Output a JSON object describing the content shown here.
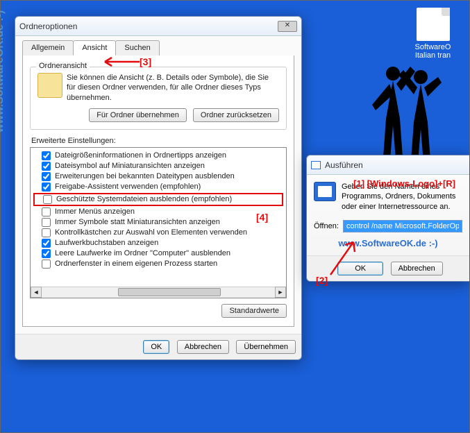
{
  "desktop": {
    "file_label": "SoftwareO\nItalian tran"
  },
  "watermark": "www.SoftwareOK.de :-)",
  "folder_options": {
    "title": "Ordneroptionen",
    "tabs": {
      "general": "Allgemein",
      "view": "Ansicht",
      "search": "Suchen"
    },
    "folderview": {
      "legend": "Ordneransicht",
      "desc": "Sie können die Ansicht (z. B. Details oder Symbole), die Sie für diesen Ordner verwenden, für alle Ordner dieses Typs übernehmen.",
      "apply_btn": "Für Ordner übernehmen",
      "reset_btn": "Ordner zurücksetzen"
    },
    "adv_label": "Erweiterte Einstellungen:",
    "items": [
      {
        "label": "Dateigrößeninformationen in Ordnertipps anzeigen",
        "checked": true
      },
      {
        "label": "Dateisymbol auf Miniaturansichten anzeigen",
        "checked": true
      },
      {
        "label": "Erweiterungen bei bekannten Dateitypen ausblenden",
        "checked": true
      },
      {
        "label": "Freigabe-Assistent verwenden (empfohlen)",
        "checked": true
      },
      {
        "label": "Geschützte Systemdateien ausblenden (empfohlen)",
        "checked": false,
        "highlight": true
      },
      {
        "label": "Immer Menüs anzeigen",
        "checked": false
      },
      {
        "label": "Immer Symbole statt Miniaturansichten anzeigen",
        "checked": false
      },
      {
        "label": "Kontrollkästchen zur Auswahl von Elementen verwenden",
        "checked": false
      },
      {
        "label": "Laufwerkbuchstaben anzeigen",
        "checked": true
      },
      {
        "label": "Leere Laufwerke im Ordner \"Computer\" ausblenden",
        "checked": true
      },
      {
        "label": "Ordnerfenster in einem eigenen Prozess starten",
        "checked": false
      }
    ],
    "defaults_btn": "Standardwerte",
    "ok": "OK",
    "cancel": "Abbrechen",
    "apply": "Übernehmen"
  },
  "run": {
    "title": "Ausführen",
    "desc": "Geben Sie den Namen eines Programms, Ordners, Dokuments oder einer Internetressource an.",
    "open_label": "Öffnen:",
    "command": "control /name Microsoft.FolderOptions",
    "ok": "OK",
    "cancel": "Abbrechen"
  },
  "annotations": {
    "a1": "[1] [Windows-Logo]+[R]",
    "a2": "[2]",
    "a3": "[3]",
    "a4": "[4]"
  }
}
